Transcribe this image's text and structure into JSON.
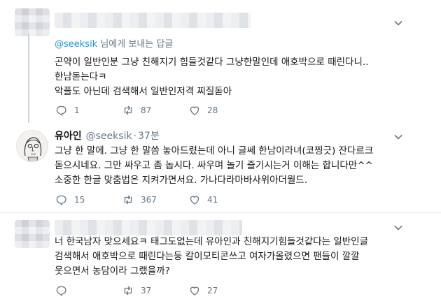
{
  "tweets": [
    {
      "replying_prefix": "@seeksik",
      "replying_suffix": " 님에게 보내는 답글",
      "lines": [
        "곤약이 일반인분 그냥 친해지기 힘들것같다 그냥한말인데 애호박으로 때린다니..",
        "한남돋는다ㅋ",
        "악플도 아닌데 검색해서 일반인저격 찌질돋아"
      ],
      "stats": {
        "replies": "1",
        "retweets": "87",
        "likes": "28"
      }
    },
    {
      "user_name": "유아인",
      "handle": "@seeksik",
      "separator": "·",
      "time": "37분",
      "lines": [
        "그냥 한 말에. 그냥 한 말씀 놓아드렸는데 아니 글쎄 한남이라녀(코찡긋) 잔다르크",
        "돋으시네요. 그만 싸우고 좀 놉시다. 싸우며 놀기 즐기시는거 이해는 합니다만^^",
        "소중한 한글 맞춤법은 지켜가면서요. 가나다라마바사위아더월드."
      ],
      "stats": {
        "replies": "15",
        "retweets": "367",
        "likes": "41"
      }
    },
    {
      "lines": [
        "너 한국남자 맞으세요ㅋ 태그도없는데 유아인과 친해지기힘들것같다는 일반인글",
        "검색해서 애호박으로 때린다는둥 칼이모티콘쓰고 여자가올렸으면 팬들이 깔깔",
        "웃으면서 농담이라 그랬을까?"
      ],
      "stats": {
        "replies": "",
        "retweets": "37",
        "likes": "27"
      }
    }
  ],
  "icons": {
    "reply": "reply-icon",
    "retweet": "retweet-icon",
    "like": "heart-icon",
    "more": "chevron-down-icon"
  },
  "colors": {
    "text": "#14171a",
    "muted": "#657786",
    "link": "#1b95e0",
    "thread_line": "#ccd6dd"
  }
}
